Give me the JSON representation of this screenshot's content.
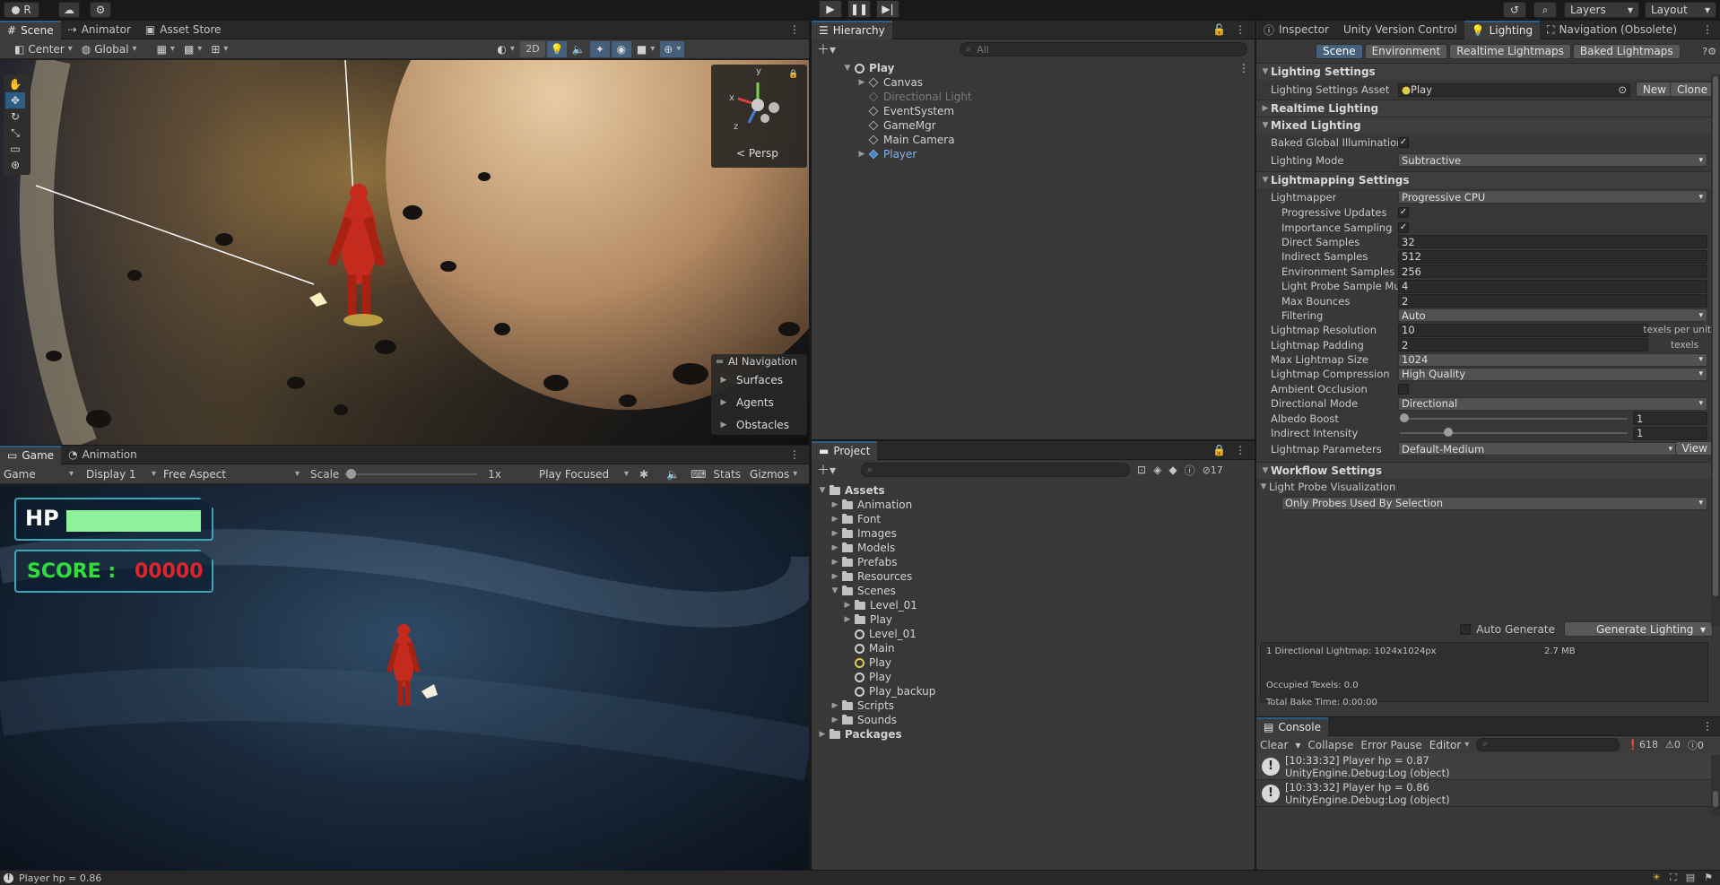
{
  "topbar": {
    "account": "R",
    "layers": "Layers",
    "layout": "Layout"
  },
  "scene_panel": {
    "tabs": [
      "Scene",
      "Animator",
      "Asset Store"
    ],
    "pivot": "Center",
    "space": "Global",
    "mode_2d": "2D",
    "persp": "Persp",
    "gizmo_axes": {
      "y": "y",
      "x": "x",
      "z": "z"
    },
    "ai_nav": {
      "title": "AI Navigation",
      "items": [
        "Surfaces",
        "Agents",
        "Obstacles"
      ]
    }
  },
  "game_panel": {
    "tabs": [
      "Game",
      "Animation"
    ],
    "mode": "Game",
    "display": "Display 1",
    "aspect": "Free Aspect",
    "scale_label": "Scale",
    "scale_value": "1x",
    "play_mode": "Play Focused",
    "stats": "Stats",
    "gizmos": "Gizmos",
    "hud": {
      "hp_label": "HP",
      "hp_fraction": 1.0,
      "score_label": "SCORE :",
      "score_value": "00000"
    }
  },
  "hierarchy": {
    "title": "Hierarchy",
    "search_placeholder": "All",
    "root": "Play",
    "items": [
      {
        "label": "Canvas",
        "disabled": false,
        "expandable": true,
        "highlight": false
      },
      {
        "label": "Directional Light",
        "disabled": true,
        "expandable": false,
        "highlight": false
      },
      {
        "label": "EventSystem",
        "disabled": false,
        "expandable": false,
        "highlight": false
      },
      {
        "label": "GameMgr",
        "disabled": false,
        "expandable": false,
        "highlight": false
      },
      {
        "label": "Main Camera",
        "disabled": false,
        "expandable": false,
        "highlight": false
      },
      {
        "label": "Player",
        "disabled": false,
        "expandable": true,
        "highlight": true
      }
    ]
  },
  "project": {
    "title": "Project",
    "hidden_count": "17",
    "assets_label": "Assets",
    "folders": [
      "Animation",
      "Font",
      "Images",
      "Models",
      "Prefabs",
      "Resources"
    ],
    "scenes_label": "Scenes",
    "scene_folders": [
      "Level_01",
      "Play"
    ],
    "scene_files": [
      "Level_01",
      "Main",
      "Play",
      "Play",
      "Play_backup"
    ],
    "more_folders": [
      "Scripts",
      "Sounds"
    ],
    "packages_label": "Packages"
  },
  "inspector": {
    "tabs": [
      "Inspector",
      "Unity Version Control",
      "Lighting",
      "Navigation (Obsolete)"
    ],
    "subtabs": [
      "Scene",
      "Environment",
      "Realtime Lightmaps",
      "Baked Lightmaps"
    ],
    "lighting_settings": {
      "title": "Lighting Settings",
      "asset_label": "Lighting Settings Asset",
      "asset_value": "Play",
      "new": "New",
      "clone": "Clone"
    },
    "realtime": "Realtime Lighting",
    "mixed": {
      "title": "Mixed Lighting",
      "baked_gi": "Baked Global Illumination",
      "mode_label": "Lighting Mode",
      "mode_value": "Subtractive"
    },
    "lightmapping": {
      "title": "Lightmapping Settings",
      "lightmapper_label": "Lightmapper",
      "lightmapper_value": "Progressive CPU",
      "progressive_updates": "Progressive Updates",
      "importance_sampling": "Importance Sampling",
      "direct_samples_label": "Direct Samples",
      "direct_samples": "32",
      "indirect_samples_label": "Indirect Samples",
      "indirect_samples": "512",
      "env_samples_label": "Environment Samples",
      "env_samples": "256",
      "probe_mult_label": "Light Probe Sample Multiplier",
      "probe_mult": "4",
      "max_bounces_label": "Max Bounces",
      "max_bounces": "2",
      "filtering_label": "Filtering",
      "filtering": "Auto",
      "resolution_label": "Lightmap Resolution",
      "resolution": "10",
      "resolution_unit": "texels per unit",
      "padding_label": "Lightmap Padding",
      "padding": "2",
      "padding_unit": "texels",
      "max_size_label": "Max Lightmap Size",
      "max_size": "1024",
      "compression_label": "Lightmap Compression",
      "compression": "High Quality",
      "ao_label": "Ambient Occlusion",
      "dir_mode_label": "Directional Mode",
      "dir_mode": "Directional",
      "albedo_label": "Albedo Boost",
      "albedo": "1",
      "albedo_fraction": 0.0,
      "indirect_label": "Indirect Intensity",
      "indirect": "1",
      "indirect_fraction": 0.2,
      "params_label": "Lightmap Parameters",
      "params": "Default-Medium",
      "view": "View"
    },
    "workflow": {
      "title": "Workflow Settings",
      "probe_vis": "Light Probe Visualization",
      "probe_vis_value": "Only Probes Used By Selection",
      "auto_generate": "Auto Generate",
      "generate": "Generate Lighting"
    },
    "stats": {
      "lightmaps": "1 Directional Lightmap: 1024x1024px",
      "size": "2.7 MB",
      "occupied": "Occupied Texels: 0.0",
      "bake_time": "Total Bake Time: 0:00:00"
    }
  },
  "console": {
    "title": "Console",
    "clear": "Clear",
    "collapse": "Collapse",
    "error_pause": "Error Pause",
    "editor": "Editor",
    "log_count": "618",
    "warn_count": "0",
    "err_count": "0",
    "entries": [
      {
        "line1": "[10:33:32] Player hp = 0.87",
        "line2": "UnityEngine.Debug:Log (object)"
      },
      {
        "line1": "[10:33:32] Player hp = 0.86",
        "line2": "UnityEngine.Debug:Log (object)"
      }
    ]
  },
  "statusbar": {
    "message": "Player hp = 0.86"
  }
}
